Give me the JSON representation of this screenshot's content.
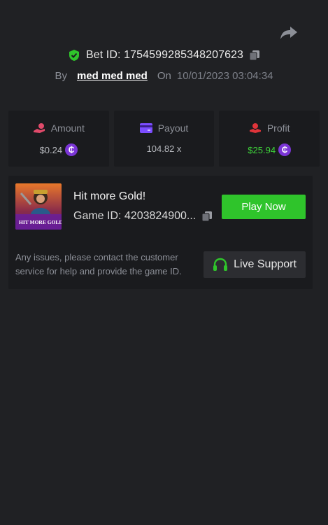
{
  "header": {
    "bet_id_label": "Bet ID: 1754599285348207623",
    "by_label": "By",
    "username": "med med med",
    "on_label": "On",
    "datetime": "10/01/2023 03:04:34"
  },
  "stats": {
    "amount": {
      "label": "Amount",
      "value": "$0.24",
      "icon": "hand-coin-icon",
      "coin": "currency-coin-icon"
    },
    "payout": {
      "label": "Payout",
      "value": "104.82 x",
      "icon": "card-icon"
    },
    "profit": {
      "label": "Profit",
      "value": "$25.94",
      "icon": "hand-coin-icon",
      "coin": "currency-coin-icon"
    }
  },
  "game": {
    "thumb_text": "HIT MORE GOLD!",
    "title": "Hit more Gold!",
    "game_id_label": "Game ID: 4203824900...",
    "play_label": "Play Now",
    "issue_text": "Any issues, please contact the customer service for help and provide the game ID.",
    "support_label": "Live Support"
  },
  "colors": {
    "background": "#202124",
    "card": "#1a1b1e",
    "accent_green": "#2fc42b",
    "profit_green": "#3ed33a",
    "coin_purple": "#7b35d6",
    "amount_icon": "#e04a6a",
    "payout_icon": "#7c4dff",
    "profit_icon": "#e0343a"
  }
}
